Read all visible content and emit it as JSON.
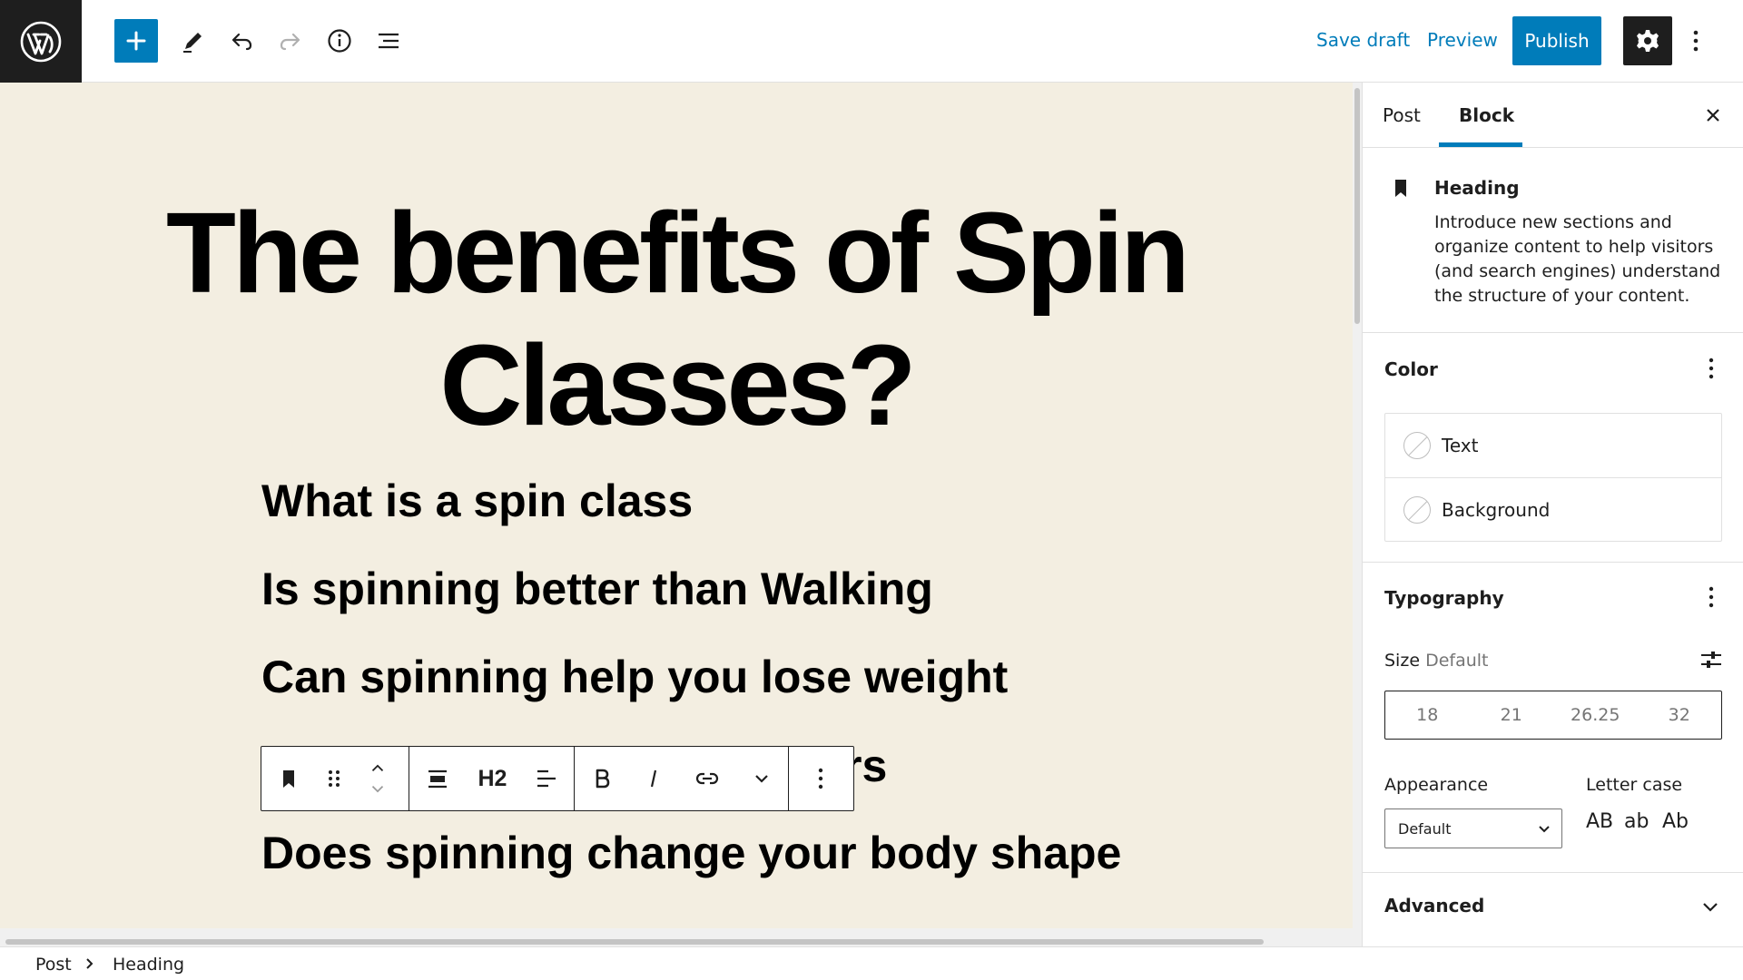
{
  "topbar": {
    "save_draft": "Save draft",
    "preview": "Preview",
    "publish": "Publish"
  },
  "canvas": {
    "title": "The benefits of Spin Classes?",
    "headings": [
      "What is a spin class",
      "Is spinning better than Walking",
      "Can spinning help you lose weight",
      "rs",
      "Does spinning change your body shape"
    ],
    "toolbar": {
      "heading_level": "H2"
    }
  },
  "sidebar": {
    "tabs": [
      "Post",
      "Block"
    ],
    "active_tab": "Block",
    "block": {
      "name": "Heading",
      "description": "Introduce new sections and organize content to help visitors (and search engines) understand the structure of your content."
    },
    "color": {
      "title": "Color",
      "options": [
        "Text",
        "Background"
      ]
    },
    "typography": {
      "title": "Typography",
      "size_label": "Size",
      "size_value": "Default",
      "sizes": [
        "18",
        "21",
        "26.25",
        "32"
      ],
      "appearance_label": "Appearance",
      "appearance_value": "Default",
      "letter_case_label": "Letter case",
      "letter_case_options": [
        "AB",
        "ab",
        "Ab"
      ]
    },
    "advanced": "Advanced"
  },
  "breadcrumb": [
    "Post",
    "Heading"
  ],
  "colors": {
    "accent": "#007cba",
    "canvas_bg": "#f3eee1",
    "dark": "#1e1e1e"
  }
}
